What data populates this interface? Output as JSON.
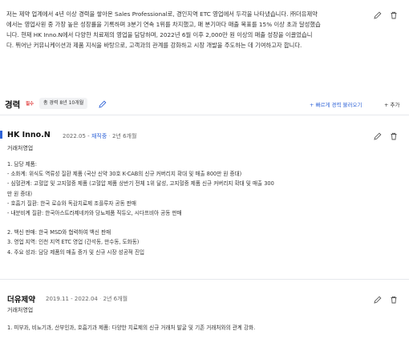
{
  "intro": {
    "lines": [
      "저는 제약 업계에서 4년 이상 경력을 쌓아온 Sales Professional로, 경인지역 ETC 영업에서 두각을 나타냈습니다. ㈜더유제약",
      "에서는 영업사원 중 가장 높은 성장률을 기록하며 3분기 연속 1위를 차지했고, 매 분기마다 매출 목표를 15% 이상 초과 달성했습",
      "니다. 현재 HK Inno.N에서 다양한 치료제의 영업을 담당하며, 2022년 6월 이후 2,000만 원 이상의 매출 성장을 이끌었습니",
      "다. 뛰어난 커뮤니케이션과 제품 지식을 바탕으로, 고객과의 관계를 강화하고 시장 개발을 주도하는 데 기여하고자 합니다."
    ]
  },
  "career": {
    "title": "경력",
    "required": "필수",
    "total_badge": "총 경력 8년 10개월",
    "fetch_label": "+ 빠르게 경력 불러오기",
    "add_label": "+ 추가"
  },
  "experiences": [
    {
      "company": "HK Inno.N",
      "period_start": "2022.05 -",
      "period_current": "재직중",
      "duration": "2년 6개월",
      "role": "거래처영업",
      "lines": [
        "1. 담당 제품:",
        "- 소화계: 위식도 역류성 질환 제품 (국산 신약 30호 K-CAB의 신규 커버리지 확대 및 매출 800만 원 증대)",
        "- 심혈관계: 고혈압 및 고지혈증 제품 (고혈압 제품 상반기 전체 1위 달성, 고지혈증 제품 신규 커버리지 확대 및 매출 300",
        "만 원 증대)",
        "- 호흡기 질환: 한국 로슈와 독감치료제 조플루자 공동 판매",
        "- 내분비계 질환: 한국아스트라제네카와 당뇨제품 직듀오, 시다프비아 공동 판매",
        "",
        "2. 백신 판매: 한국 MSD와 협력하여 백신 판매",
        "3. 영업 지역: 인천 지역 ETC 영업 (간석동, 만수동, 도화동)",
        "4. 주요 성과: 담당 제품의 매출 증가 및 신규 시장 성공적 진입"
      ]
    },
    {
      "company": "더유제약",
      "period_start": "2019.11 - 2022.04",
      "period_current": "",
      "duration": "2년 6개월",
      "role": "거래처영업",
      "lines": [
        "1. 피부과, 비뇨기과, 산부인과, 호흡기과 제품: 다양한 치료제의 신규 거래처 발굴 및 기존 거래처와의 관계 강화."
      ]
    }
  ],
  "icons": {
    "edit": "pencil-icon",
    "delete": "trash-icon"
  },
  "colors": {
    "accent": "#2f63d7",
    "required": "#e03c3c"
  }
}
